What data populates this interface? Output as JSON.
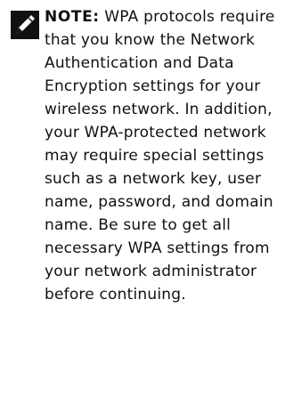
{
  "note": {
    "label": "NOTE:",
    "icon": "pencil-note-icon",
    "text": " WPA protocols require that you know the Network Authentication and Data Encryption settings for your wireless network. In addition, your WPA-protected network may require special settings such as a network key, user name, password, and domain name. Be sure to get all necessary WPA settings from your network administrator before continuing."
  }
}
